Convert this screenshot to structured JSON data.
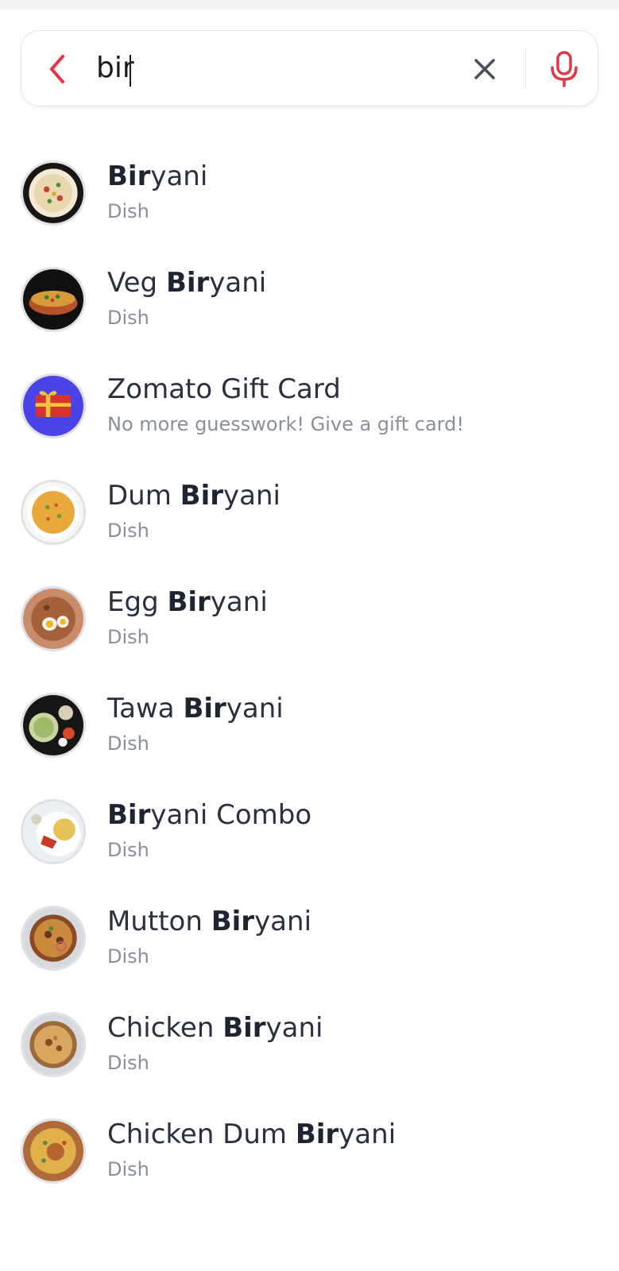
{
  "status_bar": {},
  "search": {
    "query": "bir",
    "back_icon": "chevron-left-icon",
    "clear_icon": "close-icon",
    "mic_icon": "microphone-icon",
    "accent_color": "#e23744"
  },
  "results": [
    {
      "pre": "",
      "bold": "Bir",
      "post": "yani",
      "subtitle": "Dish",
      "thumb": "biryani"
    },
    {
      "pre": "Veg ",
      "bold": "Bir",
      "post": "yani",
      "subtitle": "Dish",
      "thumb": "veg-biryani"
    },
    {
      "pre": "Zomato Gift Card",
      "bold": "",
      "post": "",
      "subtitle": "No more guesswork! Give a gift card!",
      "thumb": "gift-card"
    },
    {
      "pre": "Dum ",
      "bold": "Bir",
      "post": "yani",
      "subtitle": "Dish",
      "thumb": "dum-biryani"
    },
    {
      "pre": "Egg ",
      "bold": "Bir",
      "post": "yani",
      "subtitle": "Dish",
      "thumb": "egg-biryani"
    },
    {
      "pre": "Tawa ",
      "bold": "Bir",
      "post": "yani",
      "subtitle": "Dish",
      "thumb": "tawa-biryani"
    },
    {
      "pre": "",
      "bold": "Bir",
      "post": "yani Combo",
      "subtitle": "Dish",
      "thumb": "biryani-combo"
    },
    {
      "pre": "Mutton ",
      "bold": "Bir",
      "post": "yani",
      "subtitle": "Dish",
      "thumb": "mutton-biryani"
    },
    {
      "pre": "Chicken ",
      "bold": "Bir",
      "post": "yani",
      "subtitle": "Dish",
      "thumb": "chicken-biryani"
    },
    {
      "pre": "Chicken Dum ",
      "bold": "Bir",
      "post": "yani",
      "subtitle": "Dish",
      "thumb": "chicken-dum-biryani"
    }
  ]
}
